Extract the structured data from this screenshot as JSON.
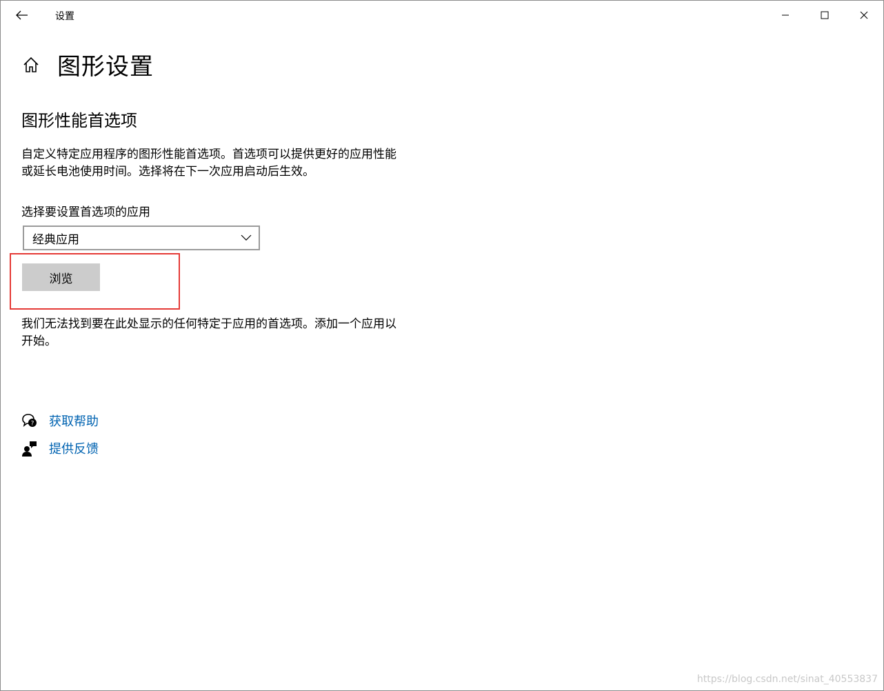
{
  "window": {
    "title": "设置",
    "controls": {
      "minimize": "minimize",
      "maximize": "maximize",
      "close": "close"
    }
  },
  "header": {
    "title": "图形设置"
  },
  "section": {
    "title": "图形性能首选项",
    "description": "自定义特定应用程序的图形性能首选项。首选项可以提供更好的应用性能或延长电池使用时间。选择将在下一次应用启动后生效。"
  },
  "app_select": {
    "label": "选择要设置首选项的应用",
    "selected": "经典应用"
  },
  "browse": {
    "label": "浏览"
  },
  "empty_message": "我们无法找到要在此处显示的任何特定于应用的首选项。添加一个应用以开始。",
  "links": {
    "help": "获取帮助",
    "feedback": "提供反馈"
  },
  "watermark": "https://blog.csdn.net/sinat_40553837",
  "colors": {
    "link": "#0063b1",
    "highlight": "#e53935",
    "button_bg": "#cccccc"
  }
}
